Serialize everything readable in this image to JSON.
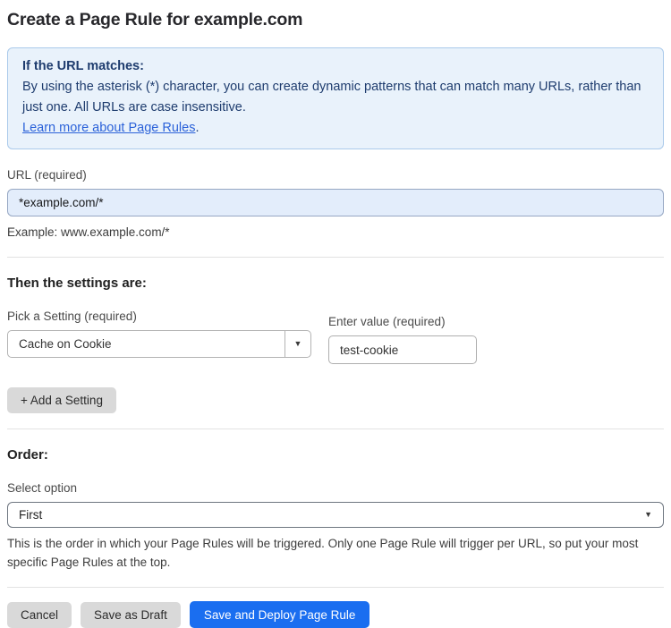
{
  "page": {
    "title": "Create a Page Rule for example.com"
  },
  "info_box": {
    "heading": "If the URL matches:",
    "body": "By using the asterisk (*) character, you can create dynamic patterns that can match many URLs, rather than just one. All URLs are case insensitive.",
    "link": "Learn more about Page Rules",
    "link_suffix": "."
  },
  "url_field": {
    "label": "URL (required)",
    "value": "*example.com/*",
    "helper": "Example: www.example.com/*"
  },
  "settings": {
    "heading": "Then the settings are:",
    "setting_label": "Pick a Setting (required)",
    "setting_value": "Cache on Cookie",
    "value_label": "Enter value (required)",
    "value_value": "test-cookie",
    "add_button_label": "+ Add a Setting"
  },
  "order": {
    "heading": "Order:",
    "label": "Select option",
    "selected": "First",
    "helper": "This is the order in which your Page Rules will be triggered. Only one Page Rule will trigger per URL, so put your most specific Page Rules at the top."
  },
  "actions": {
    "cancel_label": "Cancel",
    "save_draft_label": "Save as Draft",
    "save_deploy_label": "Save and Deploy Page Rule"
  },
  "icons": {
    "dropdown_arrow": "▼"
  },
  "colors": {
    "accent_blue": "#1a6ef0",
    "info_box_bg": "#e9f2fb",
    "info_box_border": "#aacaeb",
    "info_text": "#1e3c6e",
    "link_blue": "#2b62d9",
    "url_input_bg": "#e3edfb",
    "gray_button_bg": "#d9d9d9"
  }
}
